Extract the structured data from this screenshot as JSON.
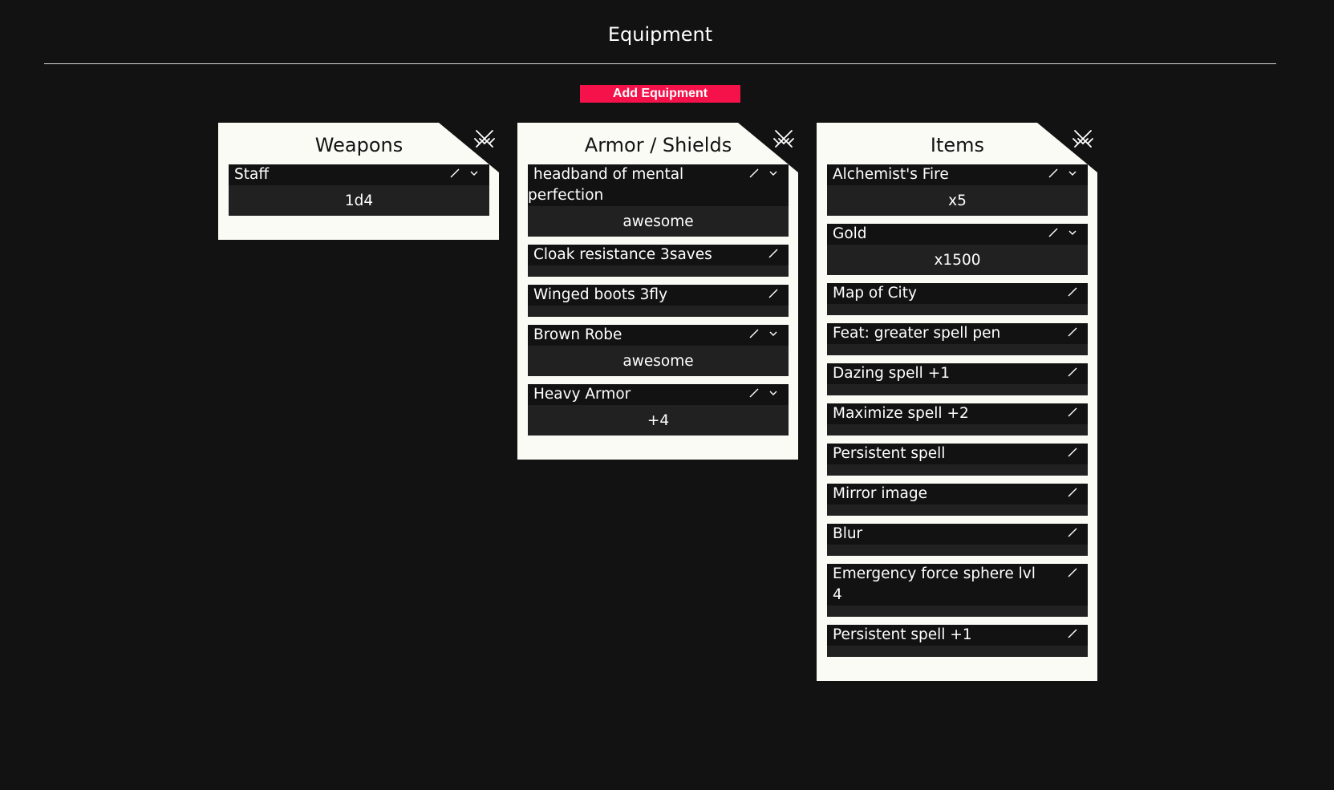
{
  "page": {
    "title": "Equipment",
    "add_button": "Add Equipment"
  },
  "panels": [
    {
      "title": "Weapons",
      "items": [
        {
          "name": "Staff",
          "detail": "1d4",
          "expandable": true
        }
      ]
    },
    {
      "title": "Armor / Shields",
      "items": [
        {
          "name": "headband of mental perfection",
          "detail": "awesome",
          "expandable": true
        },
        {
          "name": "Cloak resistance 3saves",
          "detail": "",
          "expandable": false
        },
        {
          "name": "Winged boots 3fly",
          "detail": "",
          "expandable": false
        },
        {
          "name": "Brown Robe",
          "detail": "awesome",
          "expandable": true
        },
        {
          "name": "Heavy Armor",
          "detail": "+4",
          "expandable": true
        }
      ]
    },
    {
      "title": "Items",
      "items": [
        {
          "name": "Alchemist's Fire",
          "detail": "x5",
          "expandable": true
        },
        {
          "name": "Gold",
          "detail": "x1500",
          "expandable": true
        },
        {
          "name": "Map of City",
          "detail": "",
          "expandable": false
        },
        {
          "name": "Feat: greater spell pen",
          "detail": "",
          "expandable": false
        },
        {
          "name": "Dazing spell +1",
          "detail": "",
          "expandable": false
        },
        {
          "name": "Maximize spell +2",
          "detail": "",
          "expandable": false
        },
        {
          "name": "Persistent spell",
          "detail": "",
          "expandable": false
        },
        {
          "name": "Mirror image",
          "detail": "",
          "expandable": false
        },
        {
          "name": "Blur",
          "detail": "",
          "expandable": false
        },
        {
          "name": "Emergency force sphere lvl 4",
          "detail": "",
          "expandable": false
        },
        {
          "name": "Persistent spell +1",
          "detail": "",
          "expandable": false
        }
      ]
    }
  ],
  "icons": {
    "corner": "crossed-swords-icon",
    "edit": "pencil-icon",
    "expand": "chevron-down-icon"
  },
  "colors": {
    "background": "#121212",
    "panel": "#fbfbf6",
    "item_header": "#121212",
    "item_body": "#212121",
    "accent": "#f5124a"
  }
}
